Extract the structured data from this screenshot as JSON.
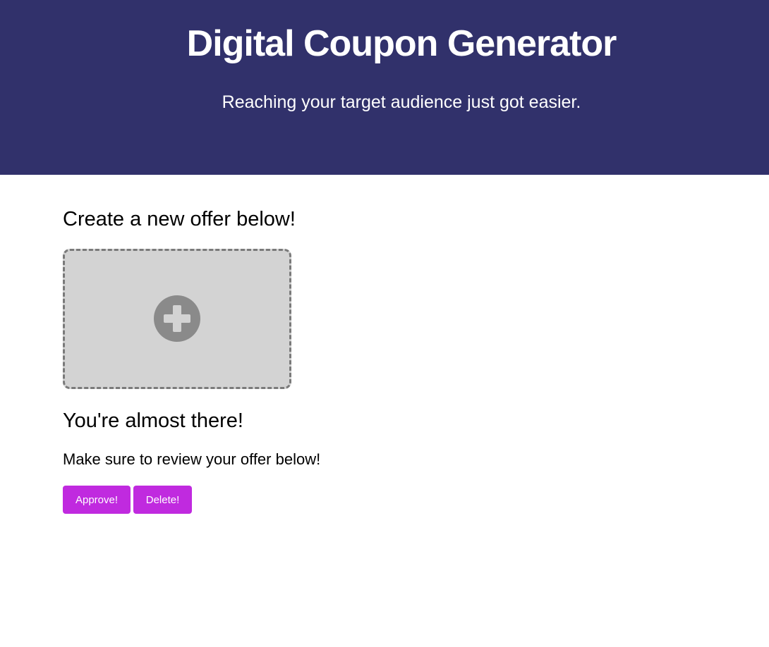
{
  "header": {
    "title": "Digital Coupon Generator",
    "subtitle": "Reaching your target audience just got easier."
  },
  "create_section": {
    "heading": "Create a new offer below!",
    "upload_icon": "plus-circle-icon"
  },
  "review_section": {
    "heading": "You're almost there!",
    "instruction": "Make sure to review your offer below!"
  },
  "actions": {
    "approve_label": "Approve!",
    "delete_label": "Delete!"
  },
  "colors": {
    "header_bg": "#31316b",
    "button_bg": "#c02adf",
    "upload_bg": "#d3d3d3",
    "icon": "#8a8a8a"
  }
}
